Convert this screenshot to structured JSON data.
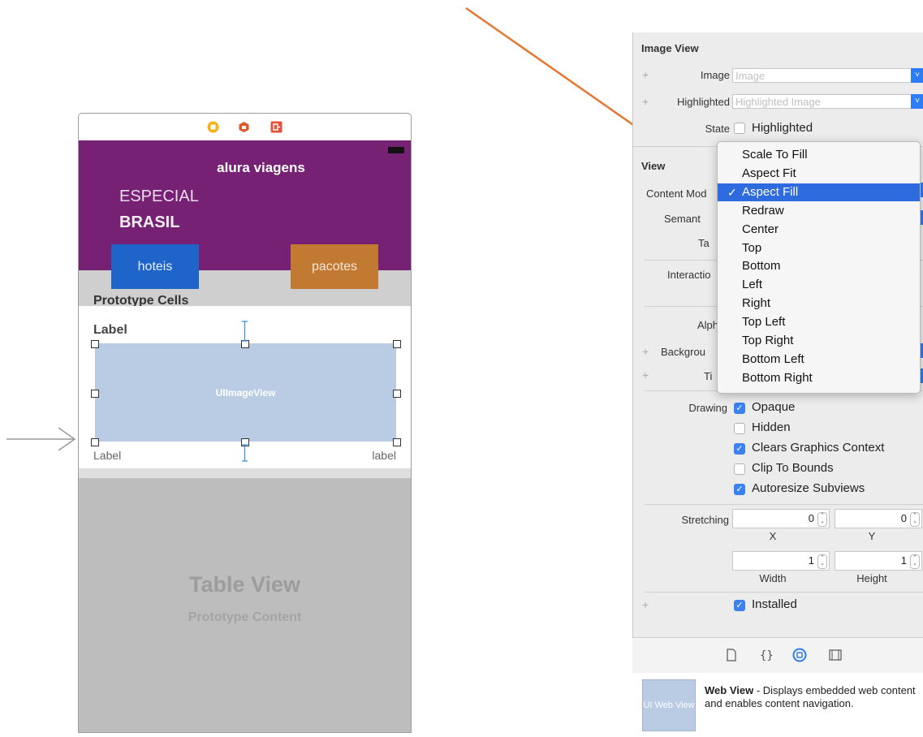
{
  "scene": {
    "app_title": "alura viagens",
    "especial": "ESPECIAL",
    "brasil": "BRASIL",
    "btn_hoteis": "hoteis",
    "btn_pacotes": "pacotes",
    "prototype_cells": "Prototype Cells",
    "cell_label": "Label",
    "image_view": "UIImageView",
    "label_left": "Label",
    "label_right": "label",
    "table_view_title": "Table View",
    "table_view_subtitle": "Prototype Content"
  },
  "inspector": {
    "image_view_section": "Image View",
    "image_label": "Image",
    "image_placeholder": "Image",
    "highlighted_label": "Highlighted",
    "highlighted_placeholder": "Highlighted Image",
    "state_label": "State",
    "state_highlighted": "Highlighted",
    "view_section": "View",
    "content_mode_label": "Content Mod",
    "semantic_label": "Semant",
    "tag_label": "Ta",
    "interaction_label": "Interactio",
    "alpha_label": "Alph",
    "background_label": "Backgrou",
    "tint_label": "Ti",
    "drawing_label": "Drawing",
    "opaque": "Opaque",
    "hidden": "Hidden",
    "clears": "Clears Graphics Context",
    "clip": "Clip To Bounds",
    "autoresize": "Autoresize Subviews",
    "stretching_label": "Stretching",
    "stretch_x_value": "0",
    "stretch_y_value": "0",
    "x_label": "X",
    "y_label": "Y",
    "width_value": "1",
    "height_value": "1",
    "width_label": "Width",
    "height_label": "Height",
    "installed": "Installed",
    "checkboxes": {
      "state_highlighted": false,
      "opaque": true,
      "hidden": false,
      "clears": true,
      "clip": false,
      "autoresize": true,
      "installed": true
    }
  },
  "dropdown": {
    "items": [
      "Scale To Fill",
      "Aspect Fit",
      "Aspect Fill",
      "Redraw",
      "Center",
      "Top",
      "Bottom",
      "Left",
      "Right",
      "Top Left",
      "Top Right",
      "Bottom Left",
      "Bottom Right"
    ],
    "selected": "Aspect Fill",
    "check": "✓"
  },
  "library": {
    "thumb": "UI Web View",
    "name": "Web View",
    "desc": " - Displays embedded web content and enables content navigation."
  },
  "colors": {
    "header": "#762173",
    "hoteis": "#1f64c8",
    "pacotes": "#c27a33",
    "selection": "#2d6bdf",
    "arrow": "#e57734"
  }
}
